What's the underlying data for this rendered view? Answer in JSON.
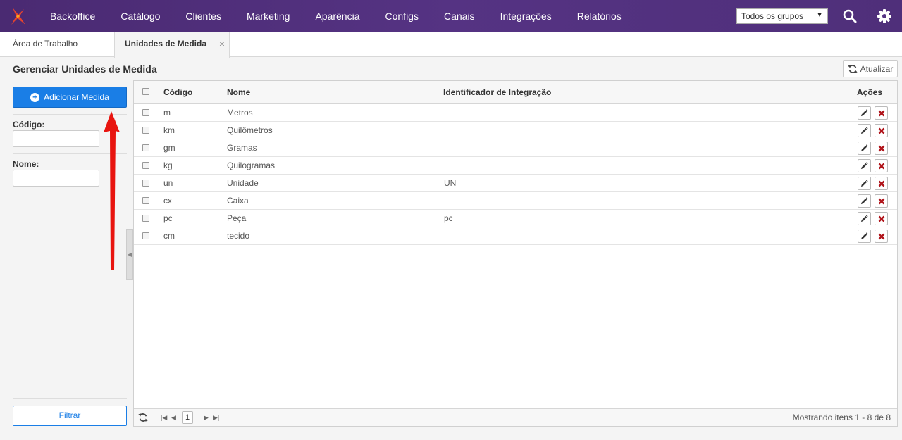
{
  "nav": {
    "items": [
      "Backoffice",
      "Catálogo",
      "Clientes",
      "Marketing",
      "Aparência",
      "Configs",
      "Canais",
      "Integrações",
      "Relatórios"
    ],
    "group_select": "Todos os grupos",
    "brand_color": "#553383"
  },
  "tabs": {
    "workspace": "Área de Trabalho",
    "active": "Unidades de Medida",
    "close": "×"
  },
  "page": {
    "title": "Gerenciar Unidades de Medida",
    "refresh_label": "Atualizar"
  },
  "sidebar": {
    "add_label": "Adicionar Medida",
    "code_label": "Código:",
    "code_value": "",
    "name_label": "Nome:",
    "name_value": "",
    "filter_label": "Filtrar"
  },
  "grid": {
    "headers": {
      "code": "Código",
      "name": "Nome",
      "integration": "Identificador de Integração",
      "actions": "Ações"
    },
    "rows": [
      {
        "code": "m",
        "name": "Metros",
        "integration": ""
      },
      {
        "code": "km",
        "name": "Quilômetros",
        "integration": ""
      },
      {
        "code": "gm",
        "name": "Gramas",
        "integration": ""
      },
      {
        "code": "kg",
        "name": "Quilogramas",
        "integration": ""
      },
      {
        "code": "un",
        "name": "Unidade",
        "integration": "UN"
      },
      {
        "code": "cx",
        "name": "Caixa",
        "integration": ""
      },
      {
        "code": "pc",
        "name": "Peça",
        "integration": "pc"
      },
      {
        "code": "cm",
        "name": "tecido",
        "integration": ""
      }
    ],
    "page_number": "1",
    "summary": "Mostrando itens 1 - 8 de 8"
  }
}
